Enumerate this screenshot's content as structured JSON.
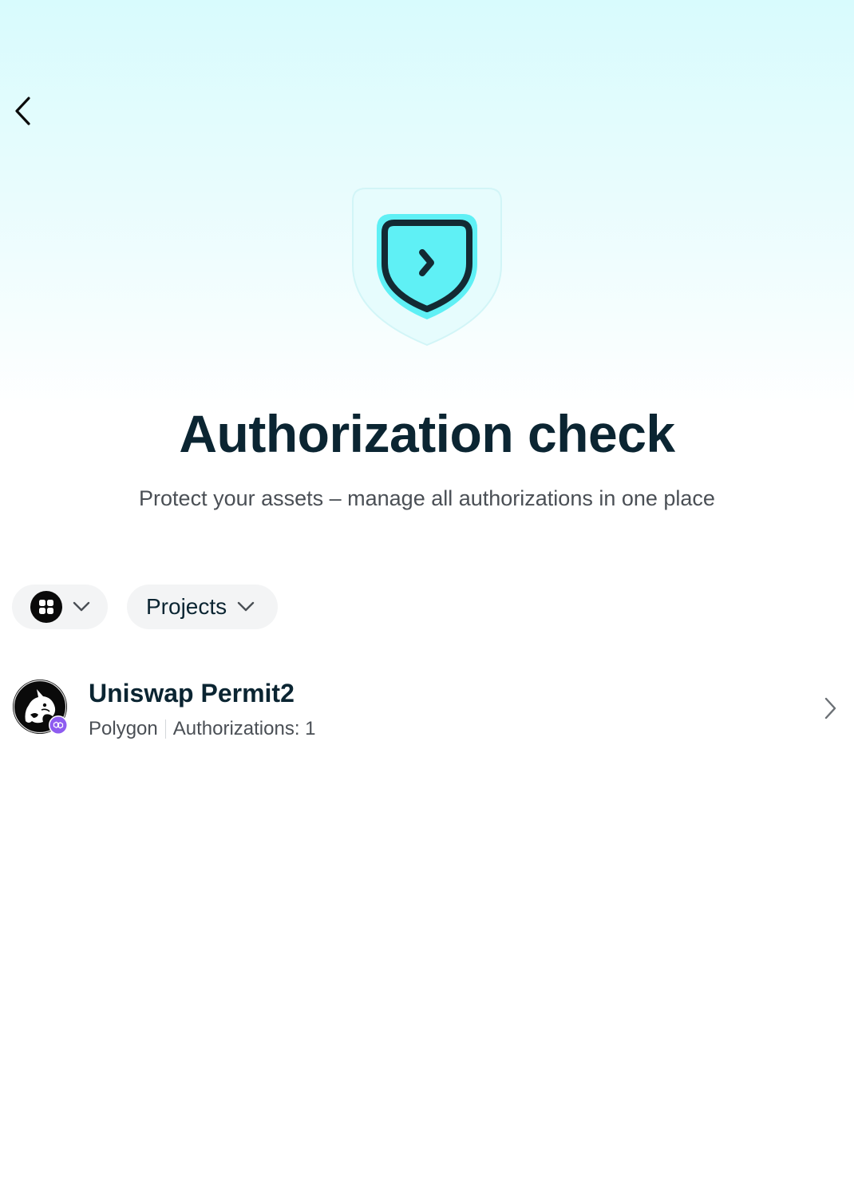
{
  "page": {
    "title": "Authorization check",
    "subtitle": "Protect your assets – manage all authorizations in one place"
  },
  "filters": {
    "chain_icon": "grid-icon",
    "projects_label": "Projects"
  },
  "projects": [
    {
      "name": "Uniswap Permit2",
      "network": "Polygon",
      "authorizations": "Authorizations: 1",
      "logo": "uniswap-unicorn-logo",
      "network_badge": "polygon-badge"
    }
  ],
  "colors": {
    "accent": "#5ff0f5",
    "title": "#0b2532",
    "polygon": "#8e5cf0"
  }
}
